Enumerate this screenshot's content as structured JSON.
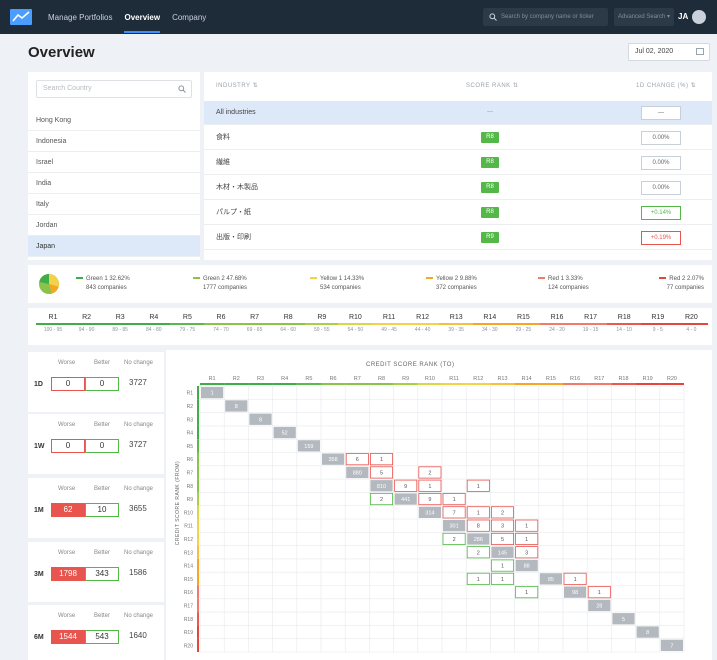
{
  "nav": {
    "items": [
      "Manage Portfolios",
      "Overview",
      "Company"
    ],
    "search_placeholder": "Search by company name or ticker",
    "advanced_search": "Advanced Search ▾",
    "user_initials": "JA"
  },
  "page": {
    "title": "Overview",
    "date": "Jul 02, 2020"
  },
  "countries": {
    "search_placeholder": "Search Country",
    "items": [
      "Hong Kong",
      "Indonesia",
      "Israel",
      "India",
      "Italy",
      "Jordan",
      "Japan"
    ],
    "selected": "Japan"
  },
  "industry_table": {
    "headers": {
      "industry": "INDUSTRY ⇅",
      "rank": "SCORE RANK ⇅",
      "change": "1D CHANGE (%) ⇅"
    },
    "rows": [
      {
        "name": "All industries",
        "rank": "—",
        "change": "—",
        "change_tone": "neutral"
      },
      {
        "name": "食料",
        "rank": "R8",
        "change": "0.00%",
        "change_tone": "neutral"
      },
      {
        "name": "繊維",
        "rank": "R8",
        "change": "0.00%",
        "change_tone": "neutral"
      },
      {
        "name": "木材・木製品",
        "rank": "R8",
        "change": "0.00%",
        "change_tone": "neutral"
      },
      {
        "name": "パルプ・紙",
        "rank": "R8",
        "change": "+0.14%",
        "change_tone": "green"
      },
      {
        "name": "出版・印刷",
        "rank": "R9",
        "change": "+0.19%",
        "change_tone": "red"
      }
    ]
  },
  "legend": [
    {
      "label": "Green 1 32.62%",
      "count": "843 companies",
      "color": "#3fae49"
    },
    {
      "label": "Green 2 47.68%",
      "count": "1777 companies",
      "color": "#8bc34a"
    },
    {
      "label": "Yellow 1 14.33%",
      "count": "534 companies",
      "color": "#f2d24b"
    },
    {
      "label": "Yellow 2 9.88%",
      "count": "372 companies",
      "color": "#f5a623"
    },
    {
      "label": "Red 1 3.33%",
      "count": "124 companies",
      "color": "#ef7b6b"
    },
    {
      "label": "Red 2 2.07%",
      "count": "77 companies",
      "color": "#e2463d"
    }
  ],
  "ranks": [
    {
      "label": "R1",
      "range": "100 - 95",
      "color": "#3fae49"
    },
    {
      "label": "R2",
      "range": "94 - 90",
      "color": "#3fae49"
    },
    {
      "label": "R3",
      "range": "89 - 85",
      "color": "#3fae49"
    },
    {
      "label": "R4",
      "range": "84 - 80",
      "color": "#3fae49"
    },
    {
      "label": "R5",
      "range": "79 - 75",
      "color": "#5cb84a"
    },
    {
      "label": "R6",
      "range": "74 - 70",
      "color": "#8bc34a"
    },
    {
      "label": "R7",
      "range": "69 - 65",
      "color": "#8bc34a"
    },
    {
      "label": "R8",
      "range": "64 - 60",
      "color": "#8bc34a"
    },
    {
      "label": "R9",
      "range": "59 - 55",
      "color": "#a8cf45"
    },
    {
      "label": "R10",
      "range": "54 - 50",
      "color": "#d6d84a"
    },
    {
      "label": "R11",
      "range": "49 - 45",
      "color": "#f2d24b"
    },
    {
      "label": "R12",
      "range": "44 - 40",
      "color": "#f2d24b"
    },
    {
      "label": "R13",
      "range": "39 - 35",
      "color": "#f5c040"
    },
    {
      "label": "R14",
      "range": "34 - 30",
      "color": "#f5a623"
    },
    {
      "label": "R15",
      "range": "29 - 25",
      "color": "#f5a623"
    },
    {
      "label": "R16",
      "range": "24 - 20",
      "color": "#ef7b6b"
    },
    {
      "label": "R17",
      "range": "19 - 15",
      "color": "#ef7b6b"
    },
    {
      "label": "R18",
      "range": "14 - 10",
      "color": "#e85a4f"
    },
    {
      "label": "R19",
      "range": "9 - 5",
      "color": "#e2463d"
    },
    {
      "label": "R20",
      "range": "4 - 0",
      "color": "#e2463d"
    }
  ],
  "change_cards": {
    "headers": {
      "worse": "Worse",
      "better": "Better",
      "no_change": "No change"
    },
    "items": [
      {
        "period": "1D",
        "worse": "0",
        "better": "0",
        "no_change": "3727",
        "worse_filled": false
      },
      {
        "period": "1W",
        "worse": "0",
        "better": "0",
        "no_change": "3727",
        "worse_filled": false
      },
      {
        "period": "1M",
        "worse": "62",
        "better": "10",
        "no_change": "3655",
        "worse_filled": true
      },
      {
        "period": "3M",
        "worse": "1798",
        "better": "343",
        "no_change": "1586",
        "worse_filled": true
      },
      {
        "period": "6M",
        "worse": "1544",
        "better": "543",
        "no_change": "1640",
        "worse_filled": true
      }
    ]
  },
  "matrix": {
    "title": "CREDIT SCORE RANK (TO)",
    "y_title": "CREDIT SCORE RANK (FROM)",
    "cells": [
      {
        "from": "R1",
        "to": "R1",
        "value": "1",
        "kind": "diag"
      },
      {
        "from": "R2",
        "to": "R2",
        "value": "8",
        "kind": "diag"
      },
      {
        "from": "R3",
        "to": "R3",
        "value": "8",
        "kind": "diag"
      },
      {
        "from": "R4",
        "to": "R4",
        "value": "52",
        "kind": "diag"
      },
      {
        "from": "R5",
        "to": "R5",
        "value": "159",
        "kind": "diag"
      },
      {
        "from": "R6",
        "to": "R6",
        "value": "358",
        "kind": "diag"
      },
      {
        "from": "R6",
        "to": "R7",
        "value": "6",
        "kind": "worse"
      },
      {
        "from": "R6",
        "to": "R8",
        "value": "1",
        "kind": "worse"
      },
      {
        "from": "R7",
        "to": "R7",
        "value": "880",
        "kind": "diag"
      },
      {
        "from": "R7",
        "to": "R8",
        "value": "5",
        "kind": "worse"
      },
      {
        "from": "R7",
        "to": "R10",
        "value": "2",
        "kind": "worse"
      },
      {
        "from": "R8",
        "to": "R8",
        "value": "810",
        "kind": "diag"
      },
      {
        "from": "R8",
        "to": "R9",
        "value": "9",
        "kind": "worse"
      },
      {
        "from": "R8",
        "to": "R10",
        "value": "1",
        "kind": "worse"
      },
      {
        "from": "R8",
        "to": "R12",
        "value": "1",
        "kind": "worse"
      },
      {
        "from": "R9",
        "to": "R8",
        "value": "2",
        "kind": "better"
      },
      {
        "from": "R9",
        "to": "R9",
        "value": "441",
        "kind": "diag"
      },
      {
        "from": "R9",
        "to": "R10",
        "value": "9",
        "kind": "worse"
      },
      {
        "from": "R9",
        "to": "R11",
        "value": "1",
        "kind": "worse"
      },
      {
        "from": "R10",
        "to": "R10",
        "value": "314",
        "kind": "diag"
      },
      {
        "from": "R10",
        "to": "R11",
        "value": "7",
        "kind": "worse"
      },
      {
        "from": "R10",
        "to": "R12",
        "value": "1",
        "kind": "worse"
      },
      {
        "from": "R10",
        "to": "R13",
        "value": "2",
        "kind": "worse"
      },
      {
        "from": "R11",
        "to": "R11",
        "value": "301",
        "kind": "diag"
      },
      {
        "from": "R11",
        "to": "R12",
        "value": "8",
        "kind": "worse"
      },
      {
        "from": "R11",
        "to": "R13",
        "value": "3",
        "kind": "worse"
      },
      {
        "from": "R11",
        "to": "R14",
        "value": "1",
        "kind": "worse"
      },
      {
        "from": "R12",
        "to": "R11",
        "value": "2",
        "kind": "better"
      },
      {
        "from": "R12",
        "to": "R12",
        "value": "286",
        "kind": "diag"
      },
      {
        "from": "R12",
        "to": "R13",
        "value": "5",
        "kind": "worse"
      },
      {
        "from": "R12",
        "to": "R14",
        "value": "1",
        "kind": "worse"
      },
      {
        "from": "R13",
        "to": "R12",
        "value": "2",
        "kind": "better"
      },
      {
        "from": "R13",
        "to": "R13",
        "value": "145",
        "kind": "diag"
      },
      {
        "from": "R13",
        "to": "R14",
        "value": "3",
        "kind": "worse"
      },
      {
        "from": "R14",
        "to": "R13",
        "value": "1",
        "kind": "better"
      },
      {
        "from": "R14",
        "to": "R14",
        "value": "88",
        "kind": "diag"
      },
      {
        "from": "R15",
        "to": "R12",
        "value": "1",
        "kind": "better"
      },
      {
        "from": "R15",
        "to": "R13",
        "value": "1",
        "kind": "better"
      },
      {
        "from": "R15",
        "to": "R15",
        "value": "85",
        "kind": "diag"
      },
      {
        "from": "R15",
        "to": "R16",
        "value": "1",
        "kind": "worse"
      },
      {
        "from": "R16",
        "to": "R14",
        "value": "1",
        "kind": "better"
      },
      {
        "from": "R16",
        "to": "R16",
        "value": "98",
        "kind": "diag"
      },
      {
        "from": "R16",
        "to": "R17",
        "value": "1",
        "kind": "worse"
      },
      {
        "from": "R17",
        "to": "R17",
        "value": "28",
        "kind": "diag"
      },
      {
        "from": "R18",
        "to": "R18",
        "value": "5",
        "kind": "diag"
      },
      {
        "from": "R19",
        "to": "R19",
        "value": "8",
        "kind": "diag"
      },
      {
        "from": "R20",
        "to": "R20",
        "value": "7",
        "kind": "diag"
      }
    ]
  },
  "colors": {
    "green": "#54b848",
    "red": "#e8554f",
    "diag": "#b3b9bf",
    "nav_bg": "#1e2b38",
    "accent": "#3f8cff"
  }
}
